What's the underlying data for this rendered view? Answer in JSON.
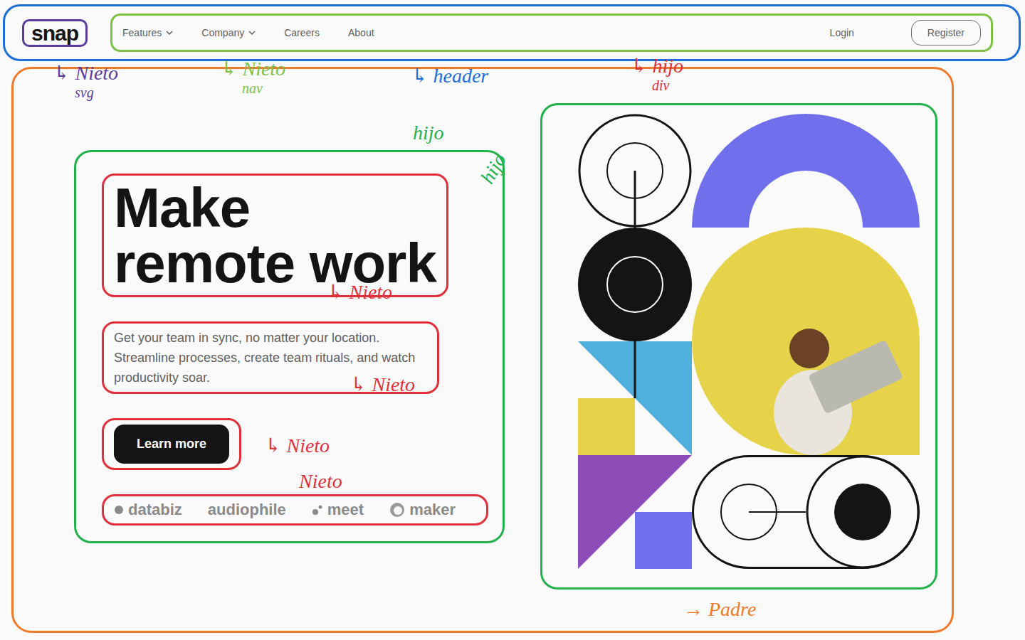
{
  "header": {
    "logo": "snap",
    "nav": [
      {
        "label": "Features",
        "dropdown": true
      },
      {
        "label": "Company",
        "dropdown": true
      },
      {
        "label": "Careers",
        "dropdown": false
      },
      {
        "label": "About",
        "dropdown": false
      }
    ],
    "login": "Login",
    "register": "Register"
  },
  "hero": {
    "title": [
      "Make",
      "remote work"
    ],
    "description": "Get your team in sync, no matter your location. Streamline processes, create team rituals, and watch productivity soar.",
    "cta": "Learn more",
    "clients": [
      "databiz",
      "audiophile",
      "meet",
      "maker"
    ]
  },
  "annotations": [
    {
      "text": "↳ Nieto",
      "note": "svg",
      "color": "#5b3c9e"
    },
    {
      "text": "↳ Nieto",
      "note": "nav",
      "color": "#7cc243"
    },
    {
      "text": "↳ header",
      "color": "#1e6fd9"
    },
    {
      "text": "↳ hijo",
      "note": "div",
      "color": "#e0303a"
    },
    {
      "text": "hijo",
      "color": "#22b24c"
    },
    {
      "text": "hijo",
      "color": "#22b24c"
    },
    {
      "text": "↳ Nieto",
      "color": "#e0303a"
    },
    {
      "text": "↳ Nieto",
      "color": "#e0303a"
    },
    {
      "text": "↳ Nieto",
      "color": "#e0303a"
    },
    {
      "text": "Nieto",
      "color": "#e0303a"
    },
    {
      "text": "→ Padre",
      "color": "#f07a2a"
    }
  ]
}
